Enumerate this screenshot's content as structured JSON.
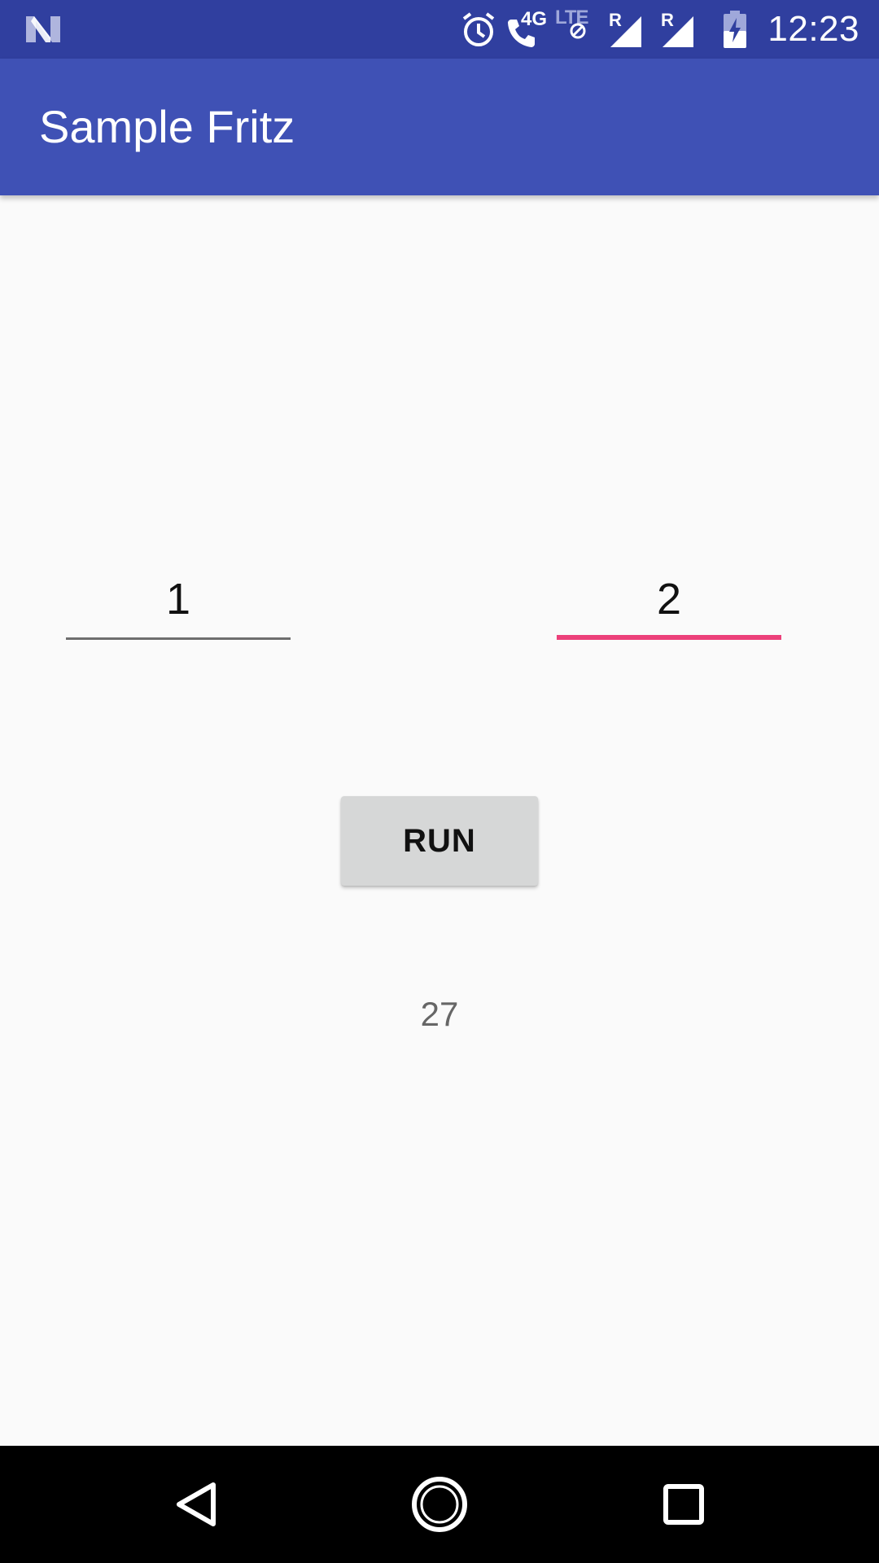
{
  "status_bar": {
    "time": "12:23",
    "icons": [
      "notification-n-icon",
      "alarm-icon",
      "call-4g-icon",
      "lte-icon",
      "signal-r-icon",
      "signal-r-icon",
      "battery-charging-icon"
    ],
    "network_label": "4G",
    "lte_label": "LTE",
    "roaming_label_1": "R",
    "roaming_label_2": "R"
  },
  "app_bar": {
    "title": "Sample Fritz",
    "color": "#3f51b5",
    "status_color": "#303f9f"
  },
  "inputs": {
    "first": {
      "value": "1"
    },
    "second": {
      "value": "2",
      "focused": true,
      "accent": "#ec407a"
    }
  },
  "run_button": {
    "label": "RUN"
  },
  "result": {
    "value": "27"
  },
  "nav_bar": {
    "icons": [
      "back-icon",
      "home-icon",
      "recents-icon"
    ]
  }
}
